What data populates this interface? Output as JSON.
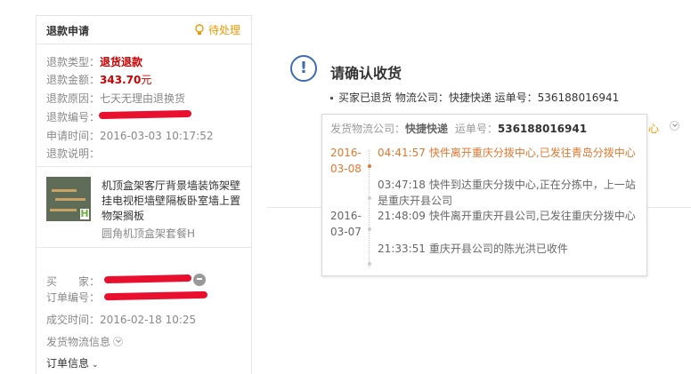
{
  "refund_panel": {
    "title": "退款申请",
    "status": "待处理",
    "type_label": "退款类型：",
    "type_value": "退货退款",
    "amount_label": "退款金额：",
    "amount_value": "343.70",
    "amount_unit": "元",
    "reason_label": "退款原因：",
    "reason_value": "七天无理由退换货",
    "number_label": "退款编号：",
    "time_label": "申请时间：",
    "time_value": "2016-03-03 10:17:52",
    "desc_label": "退款说明："
  },
  "product": {
    "title": "机顶盒架客厅背景墙装饰架壁挂电视柜墙壁隔板卧室墙上置物架搁板",
    "sku": "圆角机顶盒架套餐H",
    "thumb_badge": "H"
  },
  "order": {
    "buyer_label": "买　　家：",
    "order_no_label": "订单编号：",
    "deal_time_label": "成交时间：",
    "deal_time_value": "2016-02-18 10:25",
    "logistics_link": "发货物流信息",
    "order_info_link": "订单信息"
  },
  "confirm": {
    "title": "请确认收货",
    "note": "买家已退货 物流公司：快捷快递 运单号：536188016941"
  },
  "popup": {
    "company_label": "发货物流公司：",
    "company": "快捷快递",
    "tracking_label": "运单号：",
    "tracking": "536188016941",
    "bg_link": "心",
    "events": [
      {
        "date_line1": "2016-",
        "date_line2": "03-08",
        "time": "04:41:57",
        "text": "快件离开重庆分拨中心,已发往青岛分拨中心"
      },
      {
        "time": "03:47:18",
        "text": "快件到达重庆分拨中心,正在分拣中，上一站是重庆开县公司"
      },
      {
        "date_line1": "2016-",
        "date_line2": "03-07",
        "time": "21:48:09",
        "text": "快件离开重庆开县公司,已发往重庆分拨中心"
      },
      {
        "time": "21:33:51",
        "text": "重庆开县公司的陈光洪已收件"
      }
    ]
  },
  "colors": {
    "accent_orange": "#f39800",
    "timeline_active": "#e4762e",
    "alert_blue": "#3d6cb2",
    "red": "#cc0000"
  }
}
